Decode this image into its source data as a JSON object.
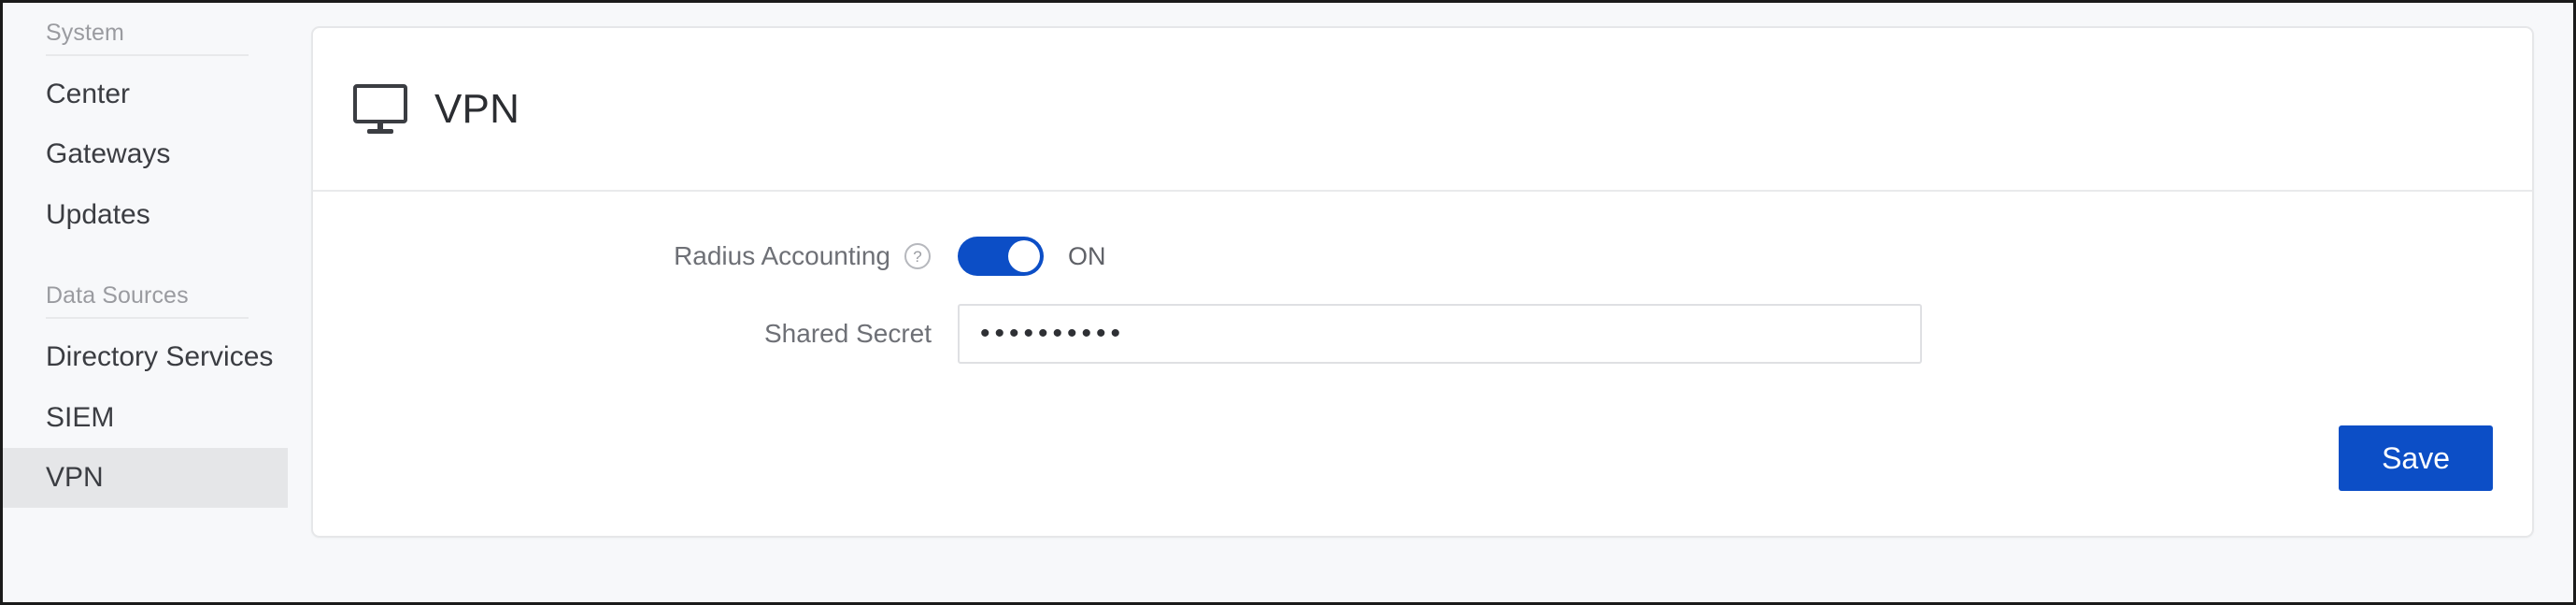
{
  "sidebar": {
    "sections": [
      {
        "header": "System",
        "items": [
          {
            "label": "Center",
            "selected": false
          },
          {
            "label": "Gateways",
            "selected": false
          },
          {
            "label": "Updates",
            "selected": false
          }
        ]
      },
      {
        "header": "Data Sources",
        "items": [
          {
            "label": "Directory Services",
            "selected": false
          },
          {
            "label": "SIEM",
            "selected": false
          },
          {
            "label": "VPN",
            "selected": true
          }
        ]
      }
    ]
  },
  "card": {
    "icon": "monitor-icon",
    "title": "VPN",
    "fields": {
      "radius_accounting": {
        "label": "Radius Accounting",
        "help_icon": "question-circle-icon",
        "toggle_state": "ON",
        "toggle_on": true,
        "toggle_color": "#0c4ec6"
      },
      "shared_secret": {
        "label": "Shared Secret",
        "value": "••••••••••",
        "placeholder": ""
      }
    },
    "save_label": "Save",
    "save_color": "#0c4ec6"
  }
}
